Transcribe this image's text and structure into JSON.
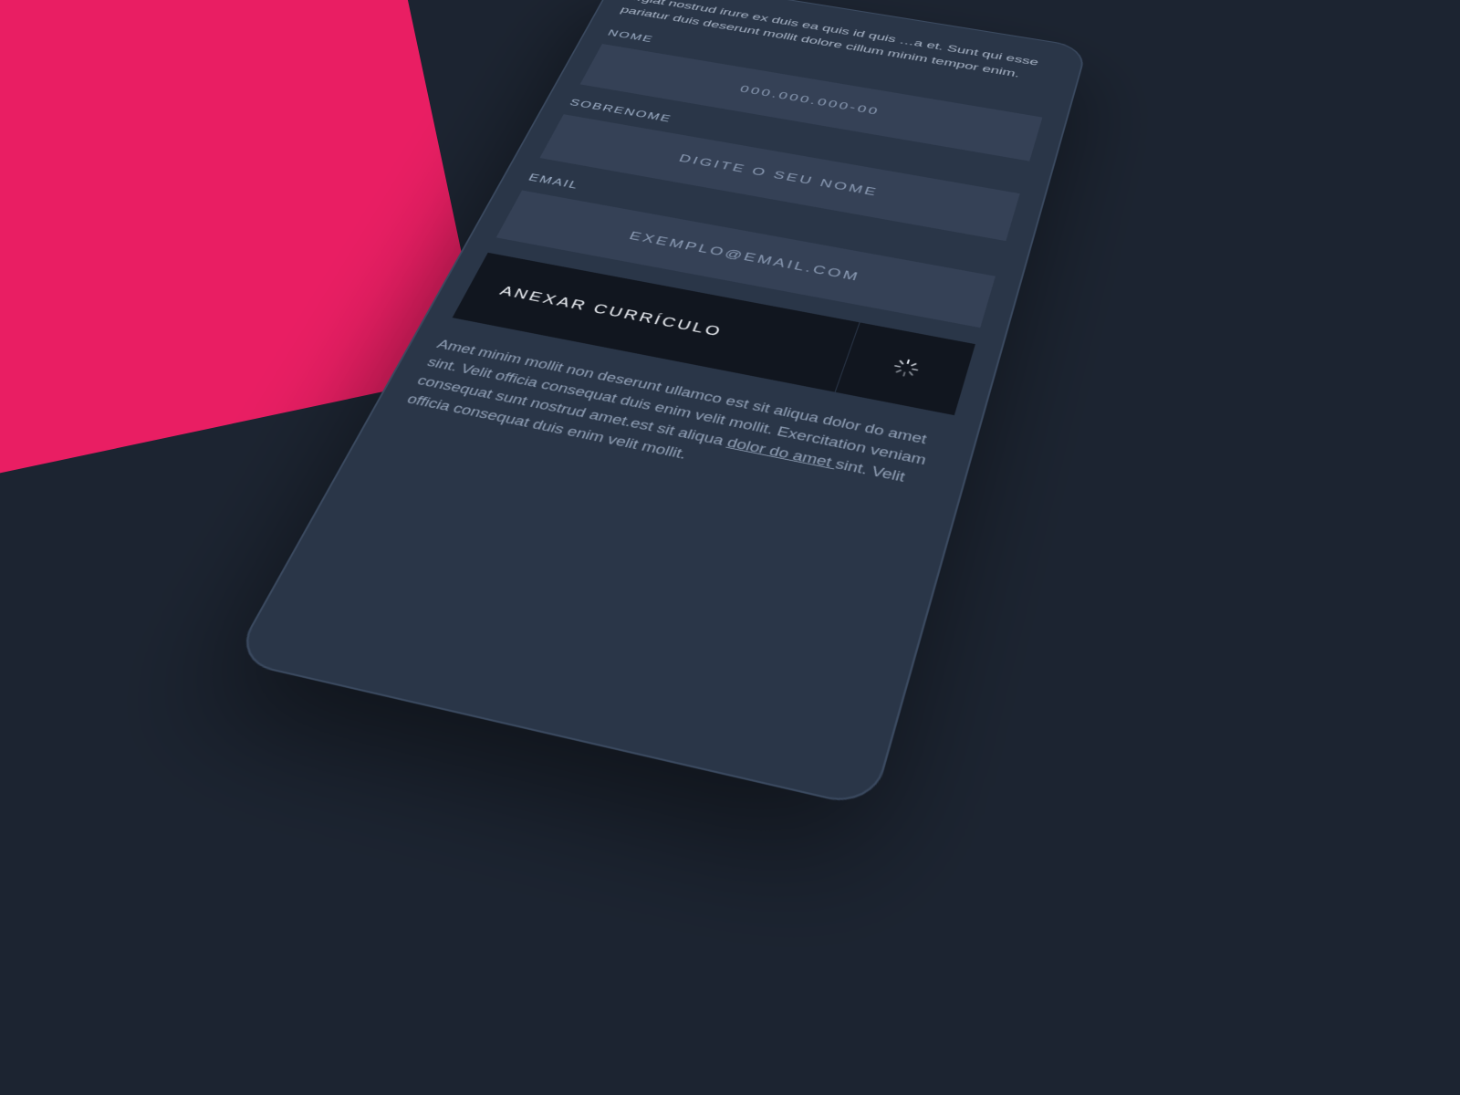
{
  "intro_text": "…giat nostrud irure ex duis ea quis id quis …a et. Sunt qui esse pariatur duis deserunt mollit dolore cillum minim tempor enim.",
  "fields": {
    "nome": {
      "label": "NOME",
      "placeholder": "000.000.000-00"
    },
    "sobrenome": {
      "label": "SOBRENOME",
      "placeholder": "DIGITE O SEU NOME"
    },
    "email": {
      "label": "EMAIL",
      "placeholder": "EXEMPLO@EMAIL.COM"
    }
  },
  "attach": {
    "label": "ANEXAR CURRÍCULO"
  },
  "footnote": {
    "pre": "Amet minim mollit non deserunt ullamco est sit aliqua dolor do amet sint. Velit officia consequat duis enim velit mollit. Exercitation veniam consequat sunt nostrud amet.est sit aliqua ",
    "link": "dolor do amet ",
    "post": "sint. Velit officia consequat duis enim velit mollit."
  }
}
